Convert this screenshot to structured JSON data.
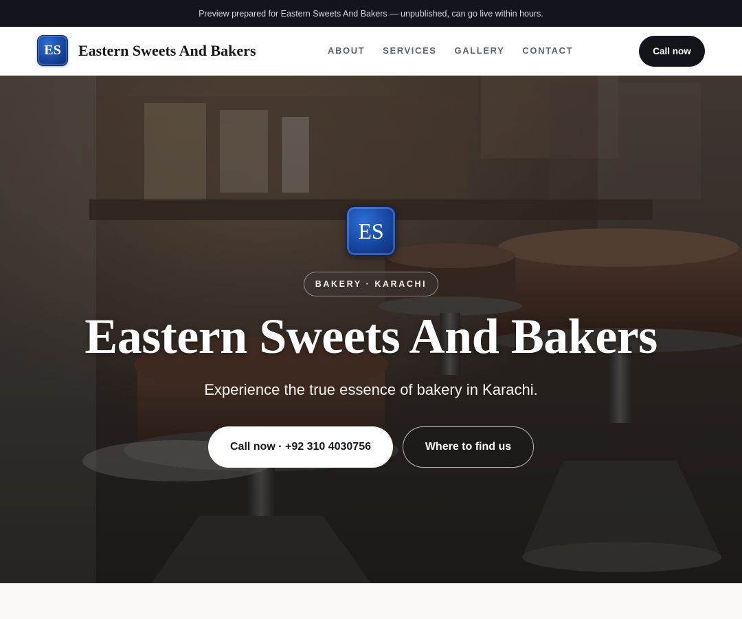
{
  "banner": {
    "text": "Preview prepared for Eastern Sweets And Bakers — unpublished, can go live within hours."
  },
  "header": {
    "logo_initials": "ES",
    "brand_name": "Eastern Sweets And Bakers",
    "nav": [
      {
        "label": "ABOUT"
      },
      {
        "label": "SERVICES"
      },
      {
        "label": "GALLERY"
      },
      {
        "label": "CONTACT"
      }
    ],
    "call_label": "Call now"
  },
  "hero": {
    "logo_initials": "ES",
    "pill": "BAKERY · KARACHI",
    "title": "Eastern Sweets And Bakers",
    "subtitle": "Experience the true essence of bakery in Karachi.",
    "primary_button": "Call now · +92 310 4030756",
    "secondary_button": "Where to find us"
  },
  "colors": {
    "banner_bg": "#12151b",
    "logo_blue": "#1646a0",
    "dark_button": "#13151b",
    "page_bg": "#faf9f6"
  }
}
